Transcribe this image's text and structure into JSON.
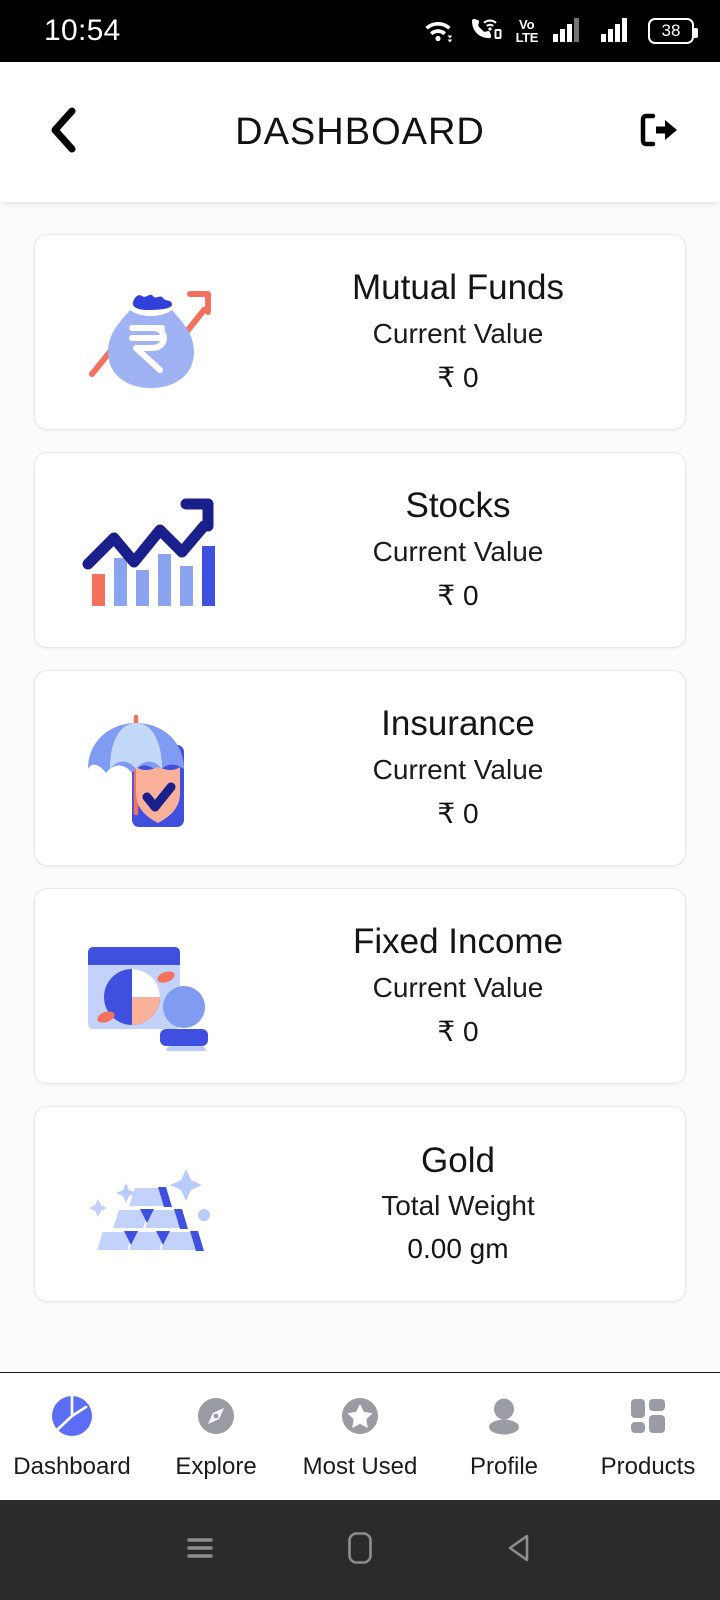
{
  "status_bar": {
    "time": "10:54",
    "battery_level": "38",
    "icons": [
      "wifi-icon",
      "vowifi-call-icon",
      "volte-icon",
      "signal-bars-sim1-icon",
      "signal-bars-sim2-icon",
      "battery-icon"
    ],
    "volte": {
      "line1": "Vo",
      "line2": "LTE",
      "sim": "2"
    }
  },
  "header": {
    "title": "DASHBOARD",
    "back_icon": "chevron-left-icon",
    "logout_icon": "logout-icon"
  },
  "cards": [
    {
      "title": "Mutual Funds",
      "sub_label": "Current Value",
      "value": "₹ 0",
      "icon": "money-bag-growth-icon"
    },
    {
      "title": "Stocks",
      "sub_label": "Current Value",
      "value": "₹ 0",
      "icon": "bar-chart-uptrend-icon"
    },
    {
      "title": "Insurance",
      "sub_label": "Current Value",
      "value": "₹ 0",
      "icon": "umbrella-shield-icon"
    },
    {
      "title": "Fixed Income",
      "sub_label": "Current Value",
      "value": "₹ 0",
      "icon": "pie-chart-person-icon"
    },
    {
      "title": "Gold",
      "sub_label": "Total Weight",
      "value": "0.00 gm",
      "icon": "gold-bars-icon"
    }
  ],
  "bottom_nav": {
    "active_index": 0,
    "items": [
      {
        "label": "Dashboard",
        "icon": "pie-chart-icon"
      },
      {
        "label": "Explore",
        "icon": "compass-icon"
      },
      {
        "label": "Most Used",
        "icon": "star-circle-icon"
      },
      {
        "label": "Profile",
        "icon": "person-icon"
      },
      {
        "label": "Products",
        "icon": "grid-icon"
      }
    ]
  },
  "system_nav": {
    "recents_icon": "recents-icon",
    "home_icon": "home-icon",
    "back_icon": "back-triangle-icon"
  },
  "colors": {
    "accent_blue": "#5b6ef5",
    "deep_blue": "#2f33c9",
    "light_periwinkle": "#9fb3f4",
    "pale_blue": "#c3d2fb",
    "coral": "#f4715d",
    "peach": "#fbb09a",
    "nav_gray": "#9a9ba4",
    "bg": "#fbfbfb"
  }
}
